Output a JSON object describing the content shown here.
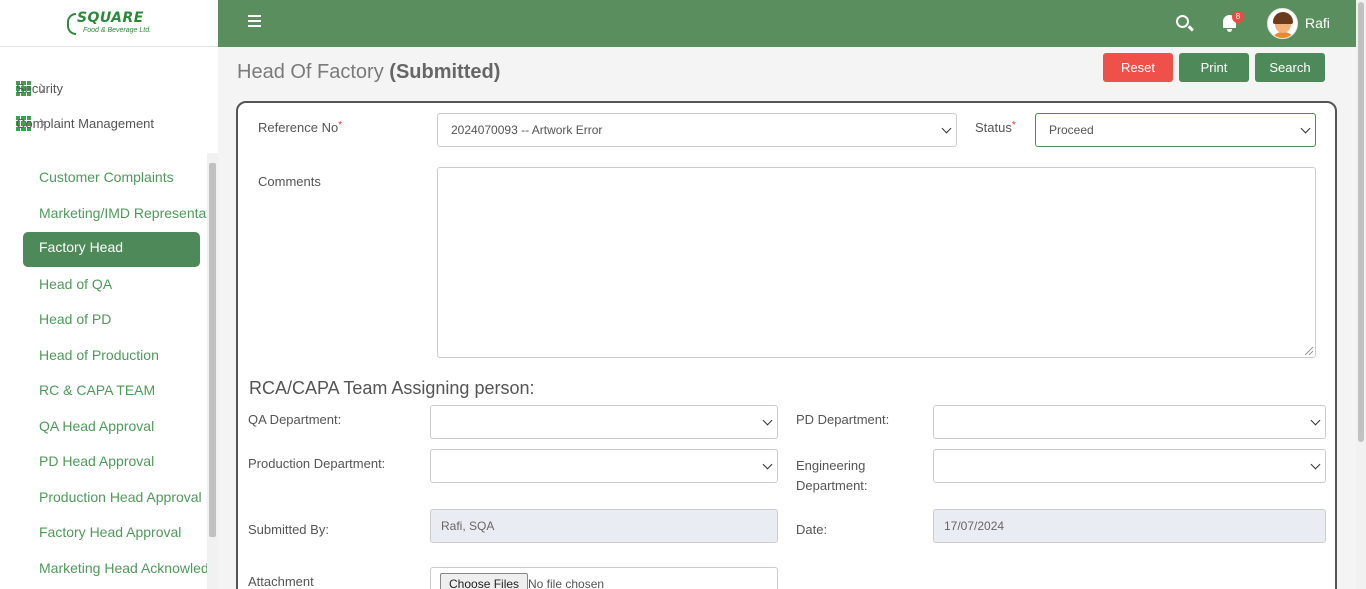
{
  "brand": {
    "name": "SQUARE",
    "tagline": "Food & Beverage Ltd."
  },
  "sidebar": {
    "menus": [
      {
        "label": "Security",
        "icon": "grid-icon"
      },
      {
        "label": "Complaint Management",
        "icon": "grid-icon"
      }
    ],
    "items": [
      "Customer Complaints",
      "Marketing/IMD Representative",
      "Factory Head",
      "Head of QA",
      "Head of PD",
      "Head of Production",
      "RC & CAPA TEAM",
      "QA Head Approval",
      "PD Head Approval",
      "Production Head Approval",
      "Factory Head Approval",
      "Marketing Head Acknowledgement"
    ],
    "active_index": 2
  },
  "topbar": {
    "notification_count": "8",
    "username": "Rafi"
  },
  "header": {
    "title": "Head Of Factory",
    "status": "(Submitted)",
    "buttons": {
      "reset": "Reset",
      "print": "Print",
      "search": "Search"
    }
  },
  "form": {
    "reference_label": "Reference No",
    "reference_value": "2024070093 -- Artwork Error",
    "status_label": "Status",
    "status_value": "Proceed",
    "comments_label": "Comments",
    "comments_value": "",
    "section_title": "RCA/CAPA Team Assigning person:",
    "qa_label": "QA Department:",
    "qa_value": "",
    "pd_label": "PD Department:",
    "pd_value": "",
    "production_label": "Production Department:",
    "production_value": "",
    "engineering_label_1": "Engineering",
    "engineering_label_2": "Department:",
    "engineering_value": "",
    "submitted_by_label": "Submitted By:",
    "submitted_by_value": "Rafi, SQA",
    "date_label": "Date:",
    "date_value": "17/07/2024",
    "attachment_label": "Attachment",
    "file_button": "Choose Files",
    "file_status": "No file chosen"
  },
  "colors": {
    "topbar": "#5a8e5f",
    "primary_button": "#4e8a59",
    "danger_button": "#f0504a",
    "link_green": "#4f9a5a",
    "required": "#e53935"
  }
}
